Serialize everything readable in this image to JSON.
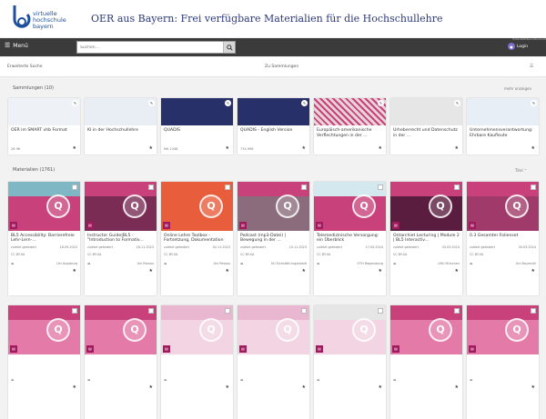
{
  "header": {
    "logo_line1": "virtuelle",
    "logo_line2": "hochschule",
    "logo_line3": "bayern",
    "title": "OER aus Bayern: Frei verfügbare Materialien für die Hochschullehre"
  },
  "toolbar": {
    "menu_label": "Menü",
    "search_placeholder": "Suchen...",
    "login_label": "Login",
    "login_tip": "Unterstütztes Dokument"
  },
  "subbar": {
    "advanced_search": "Erweiterte Suche",
    "to_collections": "Zu Sammlungen"
  },
  "collections_section": {
    "heading": "Sammlungen (10)",
    "more": "mehr anzeigen"
  },
  "collections": [
    {
      "title": "OER im SMART vhb Format",
      "stats": "26  96",
      "thumb": "#eef2f7"
    },
    {
      "title": "KI in der Hochschullehre",
      "stats": "",
      "thumb": "#e9eef5"
    },
    {
      "title": "QUADIS",
      "stats": "Mit  1348",
      "thumb": "#28306a"
    },
    {
      "title": "QUADIS - English Version",
      "stats": "734  996",
      "thumb": "#28306a"
    },
    {
      "title": "Europäisch-amerikanische Verflechtungen in der ...",
      "stats": "",
      "thumb": "#e8d4d6"
    },
    {
      "title": "Urheberrecht und Datenschutz in der ...",
      "stats": "",
      "thumb": "#e6e6e6"
    },
    {
      "title": "Unternehmensverantwortung: Ehrbare Kaufleute",
      "stats": "",
      "thumb": "#e7eef5"
    }
  ],
  "materials_section": {
    "heading": "Materialien (1761)",
    "sort": "Titel"
  },
  "materials": [
    {
      "title": "BL5 Accessibility: Barrierefreie Lehr-Lern-...",
      "status": "zuletzt geändert",
      "date": "18.09.2023",
      "license": "CC BY-SA",
      "source": "Uni Augsburg",
      "thumb_top": "#7fb7c4",
      "thumb_bottom": "#c8417a"
    },
    {
      "title": "Instructor Guide|BL5 - \"Introduction to Formativ...",
      "status": "zuletzt geändert",
      "date": "18.11.2023",
      "license": "CC BY-SA",
      "source": "Uni Passau",
      "thumb_top": "#c8417a",
      "thumb_bottom": "#7a2c55"
    },
    {
      "title": "Online Lehre Toolbox - Fortsetzung, Dokumentation",
      "status": "zuletzt geändert",
      "date": "02.11.2023",
      "license": "CC BY-SA",
      "source": "Uni Passau",
      "thumb_top": "#e85d3c",
      "thumb_bottom": "#e85d3c"
    },
    {
      "title": "Podcast (mp3-Datei) | Bewegung in der ...",
      "status": "zuletzt geändert",
      "date": "10.11.2023",
      "license": "CC BY-SA",
      "source": "KU Eichstätt-Ingolstadt",
      "thumb_top": "#c8417a",
      "thumb_bottom": "#8a6c7c"
    },
    {
      "title": "Telemedizinische Versorgung: ein Überblick",
      "status": "zuletzt geändert",
      "date": "17.04.2024",
      "license": "CC BY-SA",
      "source": "OTH Regensburg",
      "thumb_top": "#d4e8ef",
      "thumb_bottom": "#c8417a"
    },
    {
      "title": "Ontarchiet Lecturing | Module 2 | BL5 Interactiv...",
      "status": "zuletzt geändert",
      "date": "03.03.2024",
      "license": "CC BY-SA",
      "source": "LMU München",
      "thumb_top": "#c8417a",
      "thumb_bottom": "#5a1d3f"
    },
    {
      "title": "0.3 Gesamter Folienset",
      "status": "zuletzt geändert",
      "date": "30.03.2024",
      "license": "CC BY-SA",
      "source": "Uni Bayreuth",
      "thumb_top": "#c8417a",
      "thumb_bottom": "#a03a6a"
    },
    {
      "title": "",
      "status": "",
      "date": "",
      "license": "",
      "source": "",
      "thumb_top": "#c8417a",
      "thumb_bottom": "#e47aa8"
    },
    {
      "title": "",
      "status": "",
      "date": "",
      "license": "",
      "source": "",
      "thumb_top": "#c8417a",
      "thumb_bottom": "#e47aa8"
    },
    {
      "title": "",
      "status": "",
      "date": "",
      "license": "",
      "source": "",
      "thumb_top": "#e9b7cf",
      "thumb_bottom": "#f2d4e2"
    },
    {
      "title": "",
      "status": "",
      "date": "",
      "license": "",
      "source": "",
      "thumb_top": "#e9b7cf",
      "thumb_bottom": "#f2d4e2"
    },
    {
      "title": "",
      "status": "",
      "date": "",
      "license": "",
      "source": "",
      "thumb_top": "#e6e6e6",
      "thumb_bottom": "#f2d4e2"
    },
    {
      "title": "",
      "status": "",
      "date": "",
      "license": "",
      "source": "",
      "thumb_top": "#c8417a",
      "thumb_bottom": "#e47aa8"
    },
    {
      "title": "",
      "status": "",
      "date": "",
      "license": "",
      "source": "",
      "thumb_top": "#c8417a",
      "thumb_bottom": "#e47aa8"
    }
  ],
  "colors": {
    "accent": "#1d4f9c",
    "toolbar": "#3b3b3b",
    "oer_pink": "#c8417a"
  }
}
